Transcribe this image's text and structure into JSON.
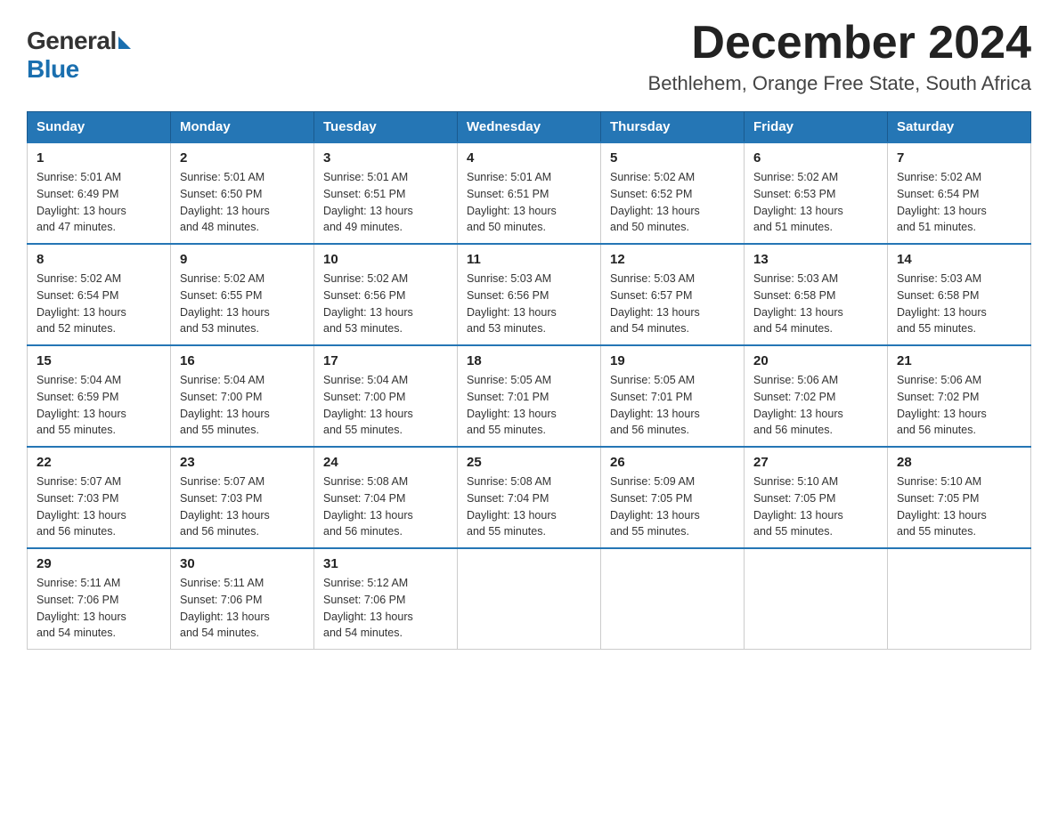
{
  "header": {
    "logo_general": "General",
    "logo_blue": "Blue",
    "month_title": "December 2024",
    "location": "Bethlehem, Orange Free State, South Africa"
  },
  "days_of_week": [
    "Sunday",
    "Monday",
    "Tuesday",
    "Wednesday",
    "Thursday",
    "Friday",
    "Saturday"
  ],
  "weeks": [
    [
      {
        "day": "1",
        "sunrise": "5:01 AM",
        "sunset": "6:49 PM",
        "daylight": "13 hours and 47 minutes."
      },
      {
        "day": "2",
        "sunrise": "5:01 AM",
        "sunset": "6:50 PM",
        "daylight": "13 hours and 48 minutes."
      },
      {
        "day": "3",
        "sunrise": "5:01 AM",
        "sunset": "6:51 PM",
        "daylight": "13 hours and 49 minutes."
      },
      {
        "day": "4",
        "sunrise": "5:01 AM",
        "sunset": "6:51 PM",
        "daylight": "13 hours and 50 minutes."
      },
      {
        "day": "5",
        "sunrise": "5:02 AM",
        "sunset": "6:52 PM",
        "daylight": "13 hours and 50 minutes."
      },
      {
        "day": "6",
        "sunrise": "5:02 AM",
        "sunset": "6:53 PM",
        "daylight": "13 hours and 51 minutes."
      },
      {
        "day": "7",
        "sunrise": "5:02 AM",
        "sunset": "6:54 PM",
        "daylight": "13 hours and 51 minutes."
      }
    ],
    [
      {
        "day": "8",
        "sunrise": "5:02 AM",
        "sunset": "6:54 PM",
        "daylight": "13 hours and 52 minutes."
      },
      {
        "day": "9",
        "sunrise": "5:02 AM",
        "sunset": "6:55 PM",
        "daylight": "13 hours and 53 minutes."
      },
      {
        "day": "10",
        "sunrise": "5:02 AM",
        "sunset": "6:56 PM",
        "daylight": "13 hours and 53 minutes."
      },
      {
        "day": "11",
        "sunrise": "5:03 AM",
        "sunset": "6:56 PM",
        "daylight": "13 hours and 53 minutes."
      },
      {
        "day": "12",
        "sunrise": "5:03 AM",
        "sunset": "6:57 PM",
        "daylight": "13 hours and 54 minutes."
      },
      {
        "day": "13",
        "sunrise": "5:03 AM",
        "sunset": "6:58 PM",
        "daylight": "13 hours and 54 minutes."
      },
      {
        "day": "14",
        "sunrise": "5:03 AM",
        "sunset": "6:58 PM",
        "daylight": "13 hours and 55 minutes."
      }
    ],
    [
      {
        "day": "15",
        "sunrise": "5:04 AM",
        "sunset": "6:59 PM",
        "daylight": "13 hours and 55 minutes."
      },
      {
        "day": "16",
        "sunrise": "5:04 AM",
        "sunset": "7:00 PM",
        "daylight": "13 hours and 55 minutes."
      },
      {
        "day": "17",
        "sunrise": "5:04 AM",
        "sunset": "7:00 PM",
        "daylight": "13 hours and 55 minutes."
      },
      {
        "day": "18",
        "sunrise": "5:05 AM",
        "sunset": "7:01 PM",
        "daylight": "13 hours and 55 minutes."
      },
      {
        "day": "19",
        "sunrise": "5:05 AM",
        "sunset": "7:01 PM",
        "daylight": "13 hours and 56 minutes."
      },
      {
        "day": "20",
        "sunrise": "5:06 AM",
        "sunset": "7:02 PM",
        "daylight": "13 hours and 56 minutes."
      },
      {
        "day": "21",
        "sunrise": "5:06 AM",
        "sunset": "7:02 PM",
        "daylight": "13 hours and 56 minutes."
      }
    ],
    [
      {
        "day": "22",
        "sunrise": "5:07 AM",
        "sunset": "7:03 PM",
        "daylight": "13 hours and 56 minutes."
      },
      {
        "day": "23",
        "sunrise": "5:07 AM",
        "sunset": "7:03 PM",
        "daylight": "13 hours and 56 minutes."
      },
      {
        "day": "24",
        "sunrise": "5:08 AM",
        "sunset": "7:04 PM",
        "daylight": "13 hours and 56 minutes."
      },
      {
        "day": "25",
        "sunrise": "5:08 AM",
        "sunset": "7:04 PM",
        "daylight": "13 hours and 55 minutes."
      },
      {
        "day": "26",
        "sunrise": "5:09 AM",
        "sunset": "7:05 PM",
        "daylight": "13 hours and 55 minutes."
      },
      {
        "day": "27",
        "sunrise": "5:10 AM",
        "sunset": "7:05 PM",
        "daylight": "13 hours and 55 minutes."
      },
      {
        "day": "28",
        "sunrise": "5:10 AM",
        "sunset": "7:05 PM",
        "daylight": "13 hours and 55 minutes."
      }
    ],
    [
      {
        "day": "29",
        "sunrise": "5:11 AM",
        "sunset": "7:06 PM",
        "daylight": "13 hours and 54 minutes."
      },
      {
        "day": "30",
        "sunrise": "5:11 AM",
        "sunset": "7:06 PM",
        "daylight": "13 hours and 54 minutes."
      },
      {
        "day": "31",
        "sunrise": "5:12 AM",
        "sunset": "7:06 PM",
        "daylight": "13 hours and 54 minutes."
      },
      null,
      null,
      null,
      null
    ]
  ]
}
